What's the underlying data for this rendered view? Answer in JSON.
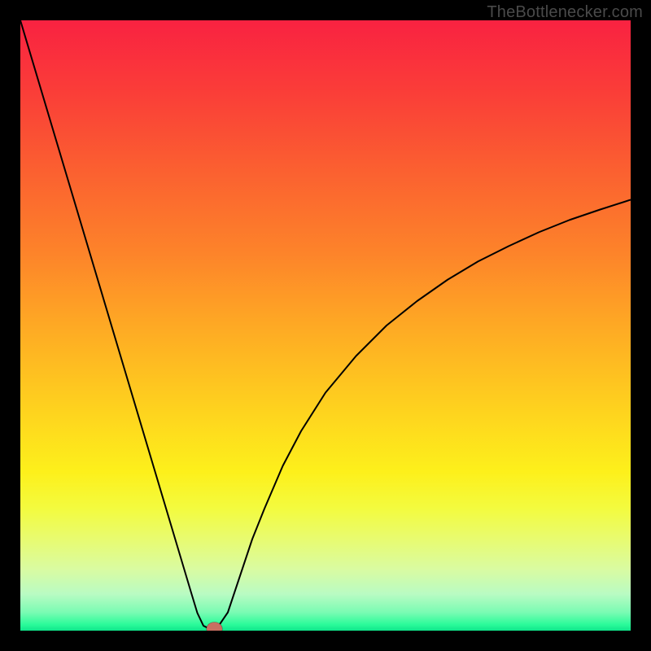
{
  "watermark": "TheBottlenecker.com",
  "chart_data": {
    "type": "line",
    "title": "",
    "xlabel": "",
    "ylabel": "",
    "xlim": [
      0,
      100
    ],
    "ylim": [
      0,
      100
    ],
    "background": {
      "gradient_stops": [
        {
          "offset": 0.0,
          "color": "#f92241"
        },
        {
          "offset": 0.12,
          "color": "#fa3e38"
        },
        {
          "offset": 0.25,
          "color": "#fb6130"
        },
        {
          "offset": 0.38,
          "color": "#fd832a"
        },
        {
          "offset": 0.5,
          "color": "#fea924"
        },
        {
          "offset": 0.62,
          "color": "#fecd1f"
        },
        {
          "offset": 0.74,
          "color": "#fdf01b"
        },
        {
          "offset": 0.8,
          "color": "#f3fb3f"
        },
        {
          "offset": 0.85,
          "color": "#e8fb70"
        },
        {
          "offset": 0.9,
          "color": "#d9fba2"
        },
        {
          "offset": 0.94,
          "color": "#b9fbc3"
        },
        {
          "offset": 0.97,
          "color": "#7afbb3"
        },
        {
          "offset": 0.99,
          "color": "#2bfb9a"
        },
        {
          "offset": 1.0,
          "color": "#0fe58b"
        }
      ]
    },
    "series": [
      {
        "name": "bottleneck-curve",
        "x": [
          0.0,
          2.0,
          4.0,
          6.0,
          8.0,
          10.0,
          12.0,
          14.0,
          16.0,
          18.0,
          20.0,
          22.0,
          24.0,
          26.0,
          28.0,
          29.0,
          30.0,
          30.8,
          31.5,
          32.5,
          34.0,
          36.0,
          38.0,
          40.0,
          43.0,
          46.0,
          50.0,
          55.0,
          60.0,
          65.0,
          70.0,
          75.0,
          80.0,
          85.0,
          90.0,
          95.0,
          100.0
        ],
        "y": [
          100.0,
          93.3,
          86.6,
          79.9,
          73.2,
          66.5,
          59.8,
          53.1,
          46.4,
          39.7,
          33.0,
          26.3,
          19.6,
          12.9,
          6.2,
          2.9,
          0.8,
          0.4,
          0.3,
          0.8,
          3.0,
          9.0,
          15.0,
          20.0,
          27.0,
          32.7,
          39.0,
          45.0,
          50.0,
          54.0,
          57.5,
          60.5,
          63.0,
          65.3,
          67.3,
          69.0,
          70.6
        ]
      }
    ],
    "marker": {
      "x": 31.8,
      "y": 0.3,
      "rx": 1.3,
      "ry": 1.1,
      "color": "#c96f62"
    }
  }
}
